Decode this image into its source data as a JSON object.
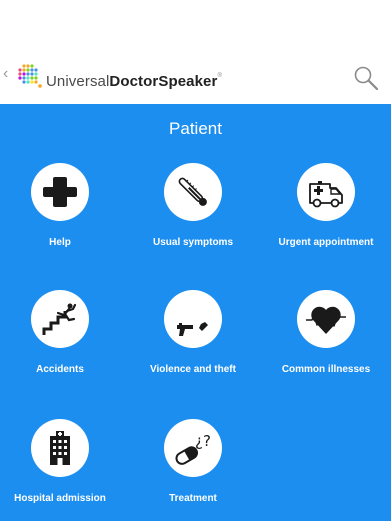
{
  "header": {
    "brand_prefix": "Universal",
    "brand_bold": "DoctorSpeaker",
    "brand_mark": "®",
    "back_icon": "chevron-left-icon",
    "search_icon": "search-icon"
  },
  "panel": {
    "title": "Patient",
    "background": "#1c8ef0",
    "tiles": [
      {
        "label": "Help",
        "icon": "medical-cross-icon"
      },
      {
        "label": "Usual symptoms",
        "icon": "thermometer-icon"
      },
      {
        "label": "Urgent appointment",
        "icon": "ambulance-icon"
      },
      {
        "label": "Accidents",
        "icon": "falling-stairs-icon"
      },
      {
        "label": "Violence and theft",
        "icon": "knife-gun-icon"
      },
      {
        "label": "Common illnesses",
        "icon": "heartbeat-icon"
      },
      {
        "label": "Hospital admission",
        "icon": "hospital-building-icon"
      },
      {
        "label": "Treatment",
        "icon": "pill-question-icon"
      }
    ]
  }
}
